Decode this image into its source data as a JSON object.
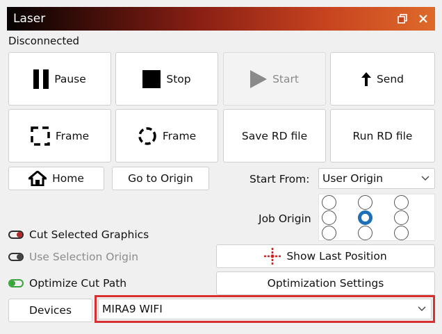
{
  "window": {
    "title": "Laser"
  },
  "status": "Disconnected",
  "buttons": {
    "pause": "Pause",
    "stop": "Stop",
    "start": "Start",
    "send": "Send",
    "frame1": "Frame",
    "frame2": "Frame",
    "save_rd": "Save RD file",
    "run_rd": "Run RD file",
    "home": "Home",
    "go_origin": "Go to Origin",
    "show_last": "Show Last Position",
    "opt_settings": "Optimization Settings",
    "devices": "Devices"
  },
  "start_from": {
    "label": "Start From:",
    "value": "User Origin"
  },
  "job_origin": {
    "label": "Job Origin",
    "selected": "center"
  },
  "toggles": [
    {
      "label": "Cut Selected Graphics",
      "state": "off",
      "color": "#b02a2a"
    },
    {
      "label": "Use Selection Origin",
      "state": "off",
      "color": "#444444"
    },
    {
      "label": "Optimize Cut Path",
      "state": "on",
      "color": "#3aa63a"
    }
  ],
  "device_select": {
    "value": "MIRA9 WIFI"
  },
  "icons": [
    "pause-icon",
    "stop-icon",
    "play-icon",
    "upload-arrow-icon",
    "frame-rect-icon",
    "frame-circle-icon",
    "home-icon",
    "crosshair-icon",
    "restore-icon",
    "close-icon",
    "chevron-down-icon"
  ],
  "colors": {
    "accent": "#1d6fb8",
    "highlight_border": "#d83030"
  }
}
